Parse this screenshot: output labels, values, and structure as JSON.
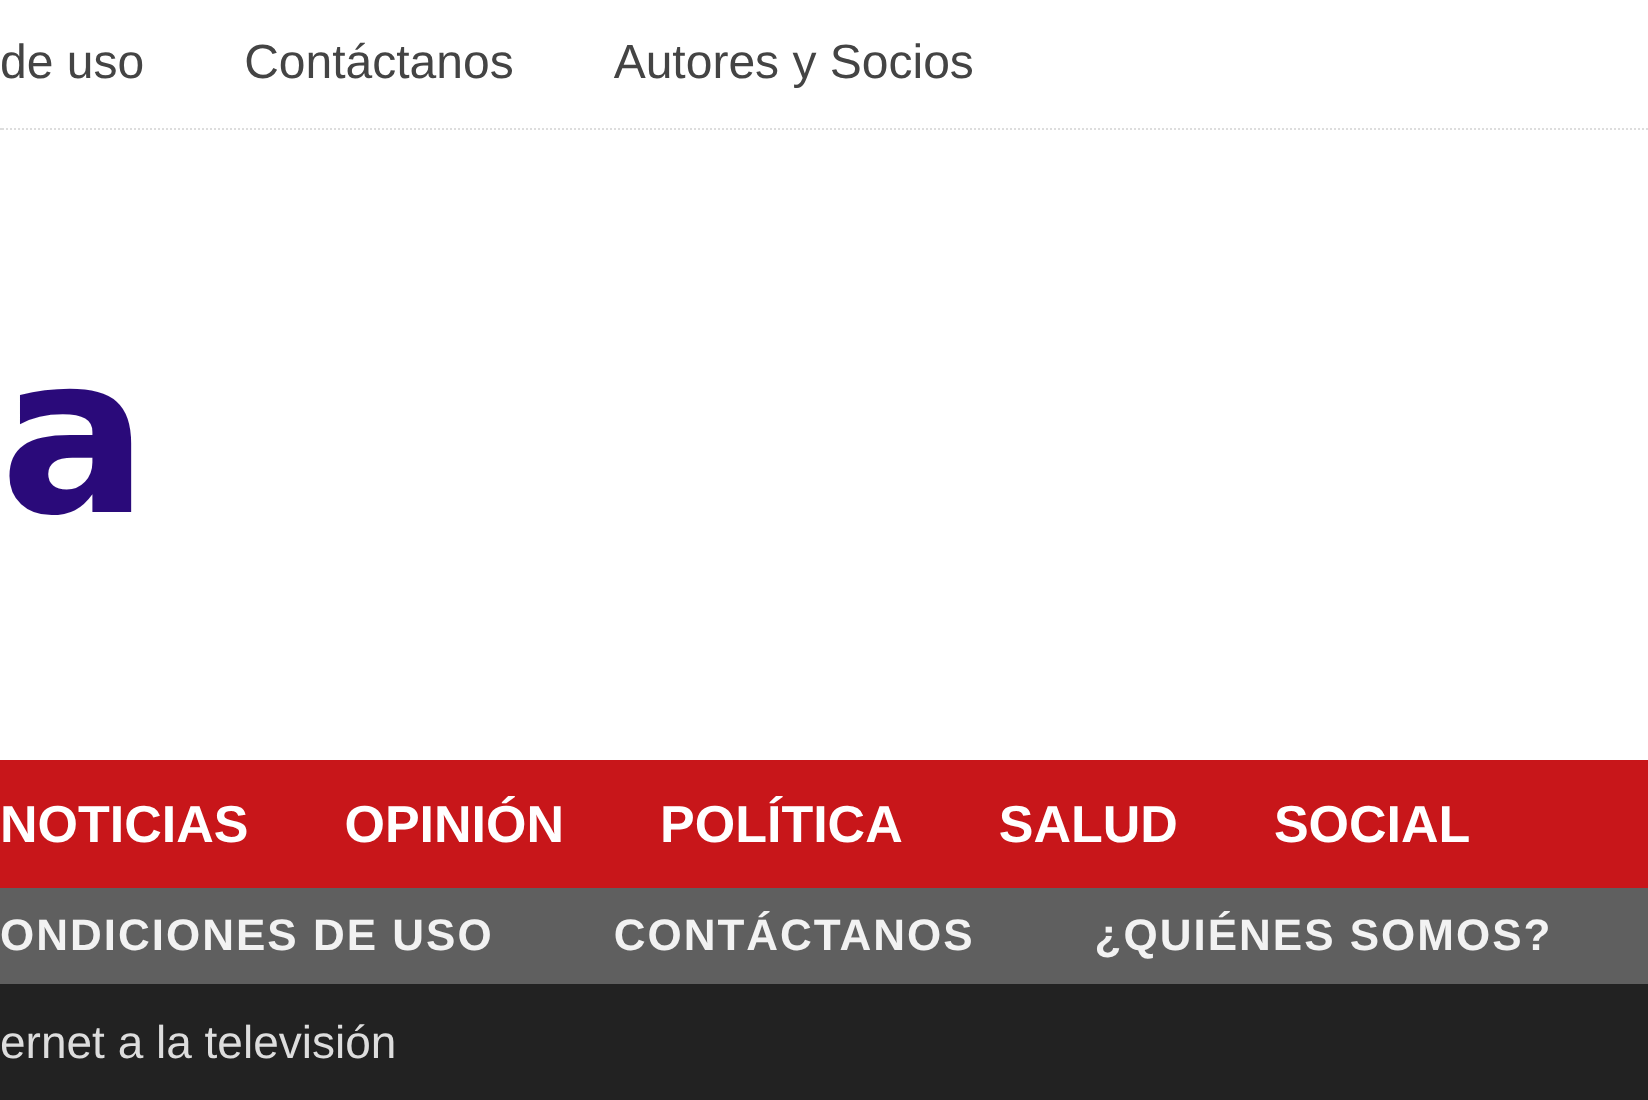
{
  "top_menu": [
    "de uso",
    "Contáctanos",
    "Autores y Socios"
  ],
  "logo": {
    "text": "a"
  },
  "main_menu": [
    "NOTICIAS",
    "OPINIÓN",
    "POLÍTICA",
    "SALUD",
    "SOCIAL"
  ],
  "secondary_menu": [
    "ONDICIONES DE USO",
    "CONTÁCTANOS",
    "¿QUIÉNES SOMOS?"
  ],
  "ticker": {
    "text": "ernet a la televisión"
  }
}
